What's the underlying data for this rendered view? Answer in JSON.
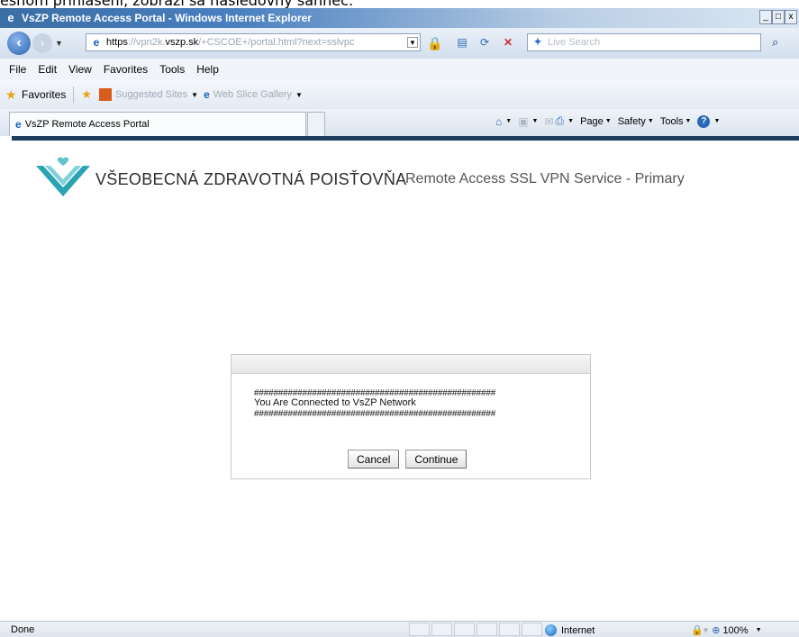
{
  "doc_fragment": "ešnom prihlásení, zobrazí sa nasledovný sahnec:",
  "window": {
    "title": "VsZP Remote Access Portal - Windows Internet Explorer",
    "minimize": "_",
    "maximize": "□",
    "close": "x"
  },
  "address": {
    "url_scheme": "https",
    "url_sub": "://vpn2k.",
    "url_domain": "vszp.sk",
    "url_rest": "/+CSCOE+/portal.html?next=sslvpc",
    "search_placeholder": "Live Search"
  },
  "menu": [
    "File",
    "Edit",
    "View",
    "Favorites",
    "Tools",
    "Help"
  ],
  "favorites": {
    "label": "Favorites",
    "suggested_sites": "Suggested Sites",
    "web_slice_gallery": "Web Slice Gallery"
  },
  "tab": {
    "title": "VsZP Remote Access Portal"
  },
  "commands": {
    "page": "Page",
    "safety": "Safety",
    "tools": "Tools"
  },
  "page": {
    "brand": "VŠEOBECNÁ ZDRAVOTNÁ POISŤOVŇA",
    "service_title": "Remote Access SSL VPN Service - Primary",
    "brand_color": "#2aa3b3"
  },
  "dialog": {
    "banner_top": "##################################################",
    "message": "You Are Connected to VsZP Network",
    "banner_bottom": "##################################################",
    "cancel_label": "Cancel",
    "continue_label": "Continue"
  },
  "status": {
    "text": "Done",
    "zone": "Internet",
    "zoom": "100%"
  }
}
